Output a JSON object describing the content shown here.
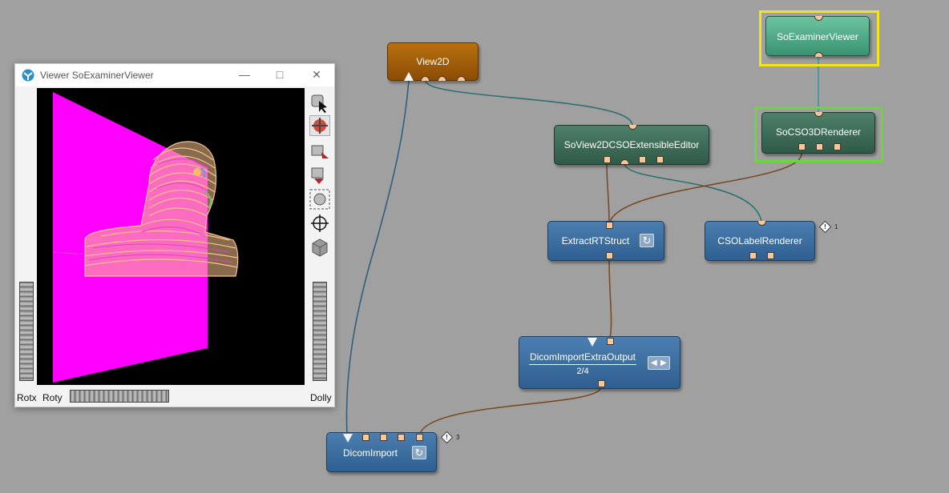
{
  "viewer": {
    "title": "Viewer SoExaminerViewer",
    "labels": {
      "rotx": "Rotx",
      "roty": "Roty",
      "dolly": "Dolly"
    },
    "tools": [
      "pick-arrow-icon",
      "view-move-icon",
      "home-icon",
      "set-home-icon",
      "view-all-icon",
      "seek-icon",
      "perspective-cube-icon"
    ]
  },
  "modules": {
    "view2d": {
      "name": "View2D"
    },
    "so_examiner_viewer": {
      "name": "SoExaminerViewer"
    },
    "so_cso3d_renderer": {
      "name": "SoCSO3DRenderer"
    },
    "so_view2d_cso_editor": {
      "name": "SoView2DCSOExtensibleEditor"
    },
    "extract_rt_struct": {
      "name": "ExtractRTStruct"
    },
    "cso_label_renderer": {
      "name": "CSOLabelRenderer",
      "info_count": "1"
    },
    "dicom_import_extra_output": {
      "name": "DicomImportExtraOutput",
      "index": "2/4"
    },
    "dicom_import": {
      "name": "DicomImport",
      "info_count": "3"
    }
  },
  "colors": {
    "canvas": "#a0a0a0",
    "selection_yellow": "#f2e416",
    "selection_green": "#6ad83a",
    "wire_blue": "#2f5f7f",
    "wire_teal": "#4a9aa0",
    "wire_brown": "#7a4a22",
    "magenta_plane": "#ff00ff",
    "head_contours": "#f7c28b"
  }
}
